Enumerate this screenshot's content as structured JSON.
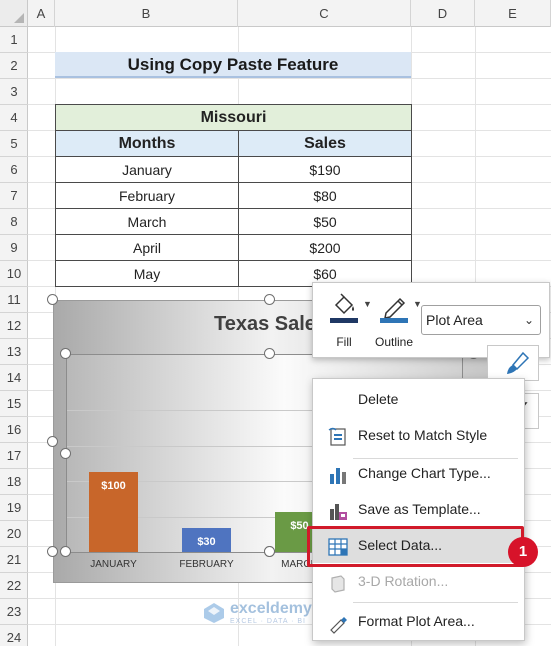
{
  "columns": [
    "A",
    "B",
    "C",
    "D",
    "E"
  ],
  "rows": [
    "1",
    "2",
    "3",
    "4",
    "5",
    "6",
    "7",
    "8",
    "9",
    "10",
    "11",
    "12",
    "13",
    "14",
    "15",
    "16",
    "17",
    "18",
    "19",
    "20",
    "21",
    "22",
    "23",
    "24"
  ],
  "sheet": {
    "title": "Using Copy Paste Feature",
    "table": {
      "state": "Missouri",
      "headers": [
        "Months",
        "Sales"
      ],
      "rows": [
        {
          "month": "January",
          "sales": "$190"
        },
        {
          "month": "February",
          "sales": "$80"
        },
        {
          "month": "March",
          "sales": "$50"
        },
        {
          "month": "April",
          "sales": "$200"
        },
        {
          "month": "May",
          "sales": "$60"
        }
      ]
    }
  },
  "chart_data": {
    "type": "bar",
    "title": "Texas Sale",
    "categories": [
      "JANUARY",
      "FEBRUARY",
      "MARCH"
    ],
    "series": [
      {
        "values": [
          100,
          30,
          50
        ],
        "labels": [
          "$100",
          "$30",
          "$50"
        ],
        "colors": [
          "#c8662a",
          "#4f74c0",
          "#6a9a45"
        ]
      }
    ],
    "grid": true
  },
  "watermark": {
    "name": "exceldemy",
    "tagline": "EXCEL · DATA · BI"
  },
  "floatie": {
    "fill_label": "Fill",
    "outline_label": "Outline",
    "element_select": "Plot Area"
  },
  "context_menu": {
    "items": [
      {
        "label": "Delete",
        "icon": "delete",
        "enabled": true
      },
      {
        "label": "Reset to Match Style",
        "icon": "reset-style-icon",
        "enabled": true
      },
      {
        "label": "Change Chart Type...",
        "icon": "chart-type-icon",
        "enabled": true
      },
      {
        "label": "Save as Template...",
        "icon": "save-template-icon",
        "enabled": true
      },
      {
        "label": "Select Data...",
        "icon": "select-data-icon",
        "enabled": true,
        "highlighted": true
      },
      {
        "label": "3-D Rotation...",
        "icon": "rotation-icon",
        "enabled": false
      },
      {
        "label": "Format Plot Area...",
        "icon": "format-icon",
        "enabled": true
      }
    ]
  },
  "step_badge": "1",
  "colors": {
    "accent_red": "#d11a2a",
    "title_fill": "#dbe7f5",
    "state_fill": "#e2efda",
    "header_fill": "#ddebf7"
  }
}
